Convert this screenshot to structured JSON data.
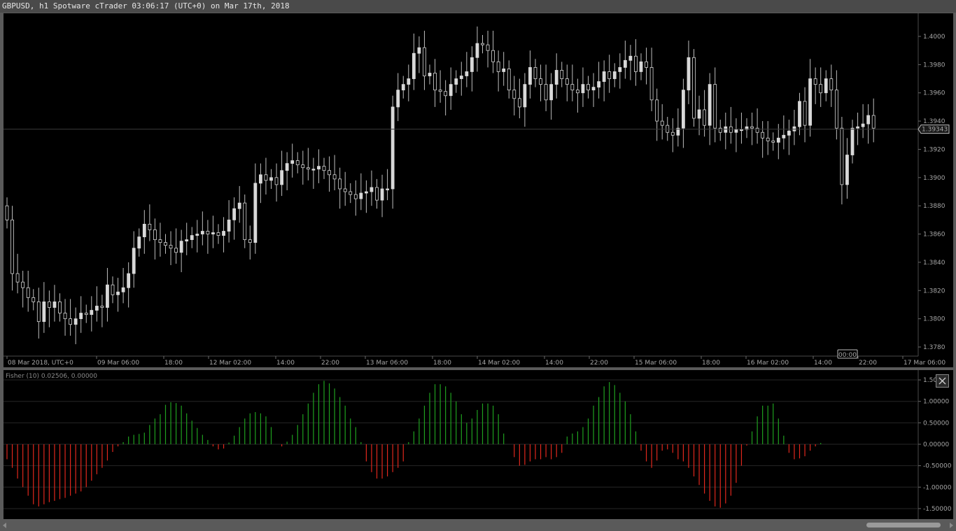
{
  "window": {
    "title": "GBPUSD, h1 Spotware cTrader 03:06:17 (UTC+0) on Mar 17th, 2018"
  },
  "colors": {
    "background": "#000000",
    "frame": "#5a5a5a",
    "candle": "#d8d8d8",
    "wick": "#bdbdbd",
    "grid": "#262626",
    "fisher_positive": "#1fa01f",
    "fisher_negative": "#e0271d",
    "price_line": "#3a3a3a"
  },
  "price_chart": {
    "current_price": "1.39343",
    "time_cursor_label": "00:00"
  },
  "indicator": {
    "label": "Fisher (10) 0.02506, 0.00000",
    "close_icon": "close-icon"
  },
  "chart_data": [
    {
      "type": "candlestick",
      "symbol": "GBPUSD",
      "timeframe": "h1",
      "ylim": [
        1.377,
        1.401
      ],
      "y_ticks": [
        "1.4000",
        "1.3980",
        "1.3960",
        "1.3940",
        "1.3920",
        "1.3900",
        "1.3880",
        "1.3860",
        "1.3840",
        "1.3820",
        "1.3800",
        "1.3780"
      ],
      "x_ticks": [
        "08 Mar 2018, UTC+0",
        "09 Mar 06:00",
        "18:00",
        "12 Mar 02:00",
        "14:00",
        "22:00",
        "13 Mar 06:00",
        "18:00",
        "14 Mar 02:00",
        "14:00",
        "22:00",
        "15 Mar 06:00",
        "18:00",
        "16 Mar 02:00",
        "14:00",
        "22:00",
        "17 Mar 06:00"
      ],
      "closes": [
        1.387,
        1.3832,
        1.3826,
        1.3822,
        1.3815,
        1.3812,
        1.3798,
        1.3812,
        1.3808,
        1.3812,
        1.3804,
        1.38,
        1.3796,
        1.38,
        1.3804,
        1.3803,
        1.3806,
        1.3809,
        1.3808,
        1.3824,
        1.3817,
        1.3819,
        1.3822,
        1.3832,
        1.385,
        1.3858,
        1.3867,
        1.3863,
        1.3856,
        1.3854,
        1.3852,
        1.385,
        1.3847,
        1.3855,
        1.3856,
        1.3859,
        1.386,
        1.3862,
        1.386,
        1.3861,
        1.3859,
        1.3862,
        1.387,
        1.3878,
        1.3882,
        1.3856,
        1.3854,
        1.3896,
        1.3902,
        1.3898,
        1.39,
        1.3895,
        1.3905,
        1.391,
        1.3912,
        1.3909,
        1.3907,
        1.3906,
        1.3906,
        1.3908,
        1.3905,
        1.3902,
        1.3899,
        1.3892,
        1.389,
        1.3888,
        1.3885,
        1.3889,
        1.389,
        1.3893,
        1.3884,
        1.3892,
        1.3892,
        1.395,
        1.3962,
        1.3966,
        1.397,
        1.3988,
        1.3992,
        1.3972,
        1.3974,
        1.3962,
        1.3961,
        1.3958,
        1.3966,
        1.397,
        1.3972,
        1.3975,
        1.3985,
        1.3995,
        1.3994,
        1.399,
        1.3982,
        1.3975,
        1.3977,
        1.3962,
        1.3956,
        1.395,
        1.3966,
        1.3978,
        1.397,
        1.3966,
        1.3955,
        1.3966,
        1.3976,
        1.397,
        1.3966,
        1.3962,
        1.396,
        1.3966,
        1.3962,
        1.3964,
        1.3968,
        1.3975,
        1.397,
        1.3975,
        1.3978,
        1.3983,
        1.3986,
        1.3975,
        1.3982,
        1.3978,
        1.3955,
        1.394,
        1.3937,
        1.3932,
        1.393,
        1.3935,
        1.3962,
        1.3985,
        1.3942,
        1.3948,
        1.3937,
        1.3966,
        1.3935,
        1.3932,
        1.3936,
        1.3932,
        1.3934,
        1.3934,
        1.3936,
        1.3935,
        1.3932,
        1.3928,
        1.3926,
        1.3925,
        1.3928,
        1.393,
        1.3933,
        1.3936,
        1.3954,
        1.3937,
        1.397,
        1.3966,
        1.396,
        1.397,
        1.3962,
        1.3935,
        1.3895,
        1.3916,
        1.3935,
        1.3936,
        1.3938,
        1.3944,
        1.3935
      ],
      "y_grid": false
    },
    {
      "type": "bar",
      "name": "Fisher (10)",
      "ylim": [
        -1.75,
        1.65
      ],
      "y_ticks": [
        "1.50000",
        "1.00000",
        "0.50000",
        "0.00000",
        "-0.50000",
        "-1.00000",
        "-1.50000"
      ],
      "values": [
        -0.35,
        -0.55,
        -0.8,
        -1.0,
        -1.2,
        -1.4,
        -1.45,
        -1.4,
        -1.35,
        -1.32,
        -1.28,
        -1.25,
        -1.2,
        -1.15,
        -1.1,
        -1.0,
        -0.85,
        -0.7,
        -0.55,
        -0.38,
        -0.18,
        -0.05,
        0.05,
        0.18,
        0.22,
        0.24,
        0.27,
        0.45,
        0.6,
        0.7,
        0.92,
        0.98,
        0.96,
        0.9,
        0.72,
        0.55,
        0.38,
        0.22,
        0.1,
        -0.05,
        -0.12,
        -0.1,
        0.04,
        0.2,
        0.4,
        0.6,
        0.72,
        0.75,
        0.72,
        0.65,
        0.4,
        0.0,
        -0.05,
        0.06,
        0.22,
        0.45,
        0.7,
        0.95,
        1.2,
        1.4,
        1.48,
        1.42,
        1.3,
        1.1,
        0.9,
        0.6,
        0.4,
        0.05,
        -0.4,
        -0.65,
        -0.8,
        -0.8,
        -0.75,
        -0.65,
        -0.55,
        -0.4,
        0.05,
        0.3,
        0.6,
        0.9,
        1.2,
        1.4,
        1.4,
        1.35,
        1.2,
        1.0,
        0.7,
        0.5,
        0.6,
        0.8,
        0.95,
        0.95,
        0.9,
        0.7,
        0.25,
        0.0,
        -0.3,
        -0.5,
        -0.48,
        -0.4,
        -0.35,
        -0.35,
        -0.3,
        -0.35,
        -0.3,
        -0.2,
        0.18,
        0.25,
        0.3,
        0.4,
        0.6,
        0.9,
        1.1,
        1.35,
        1.45,
        1.38,
        1.2,
        1.0,
        0.7,
        0.3,
        -0.15,
        -0.4,
        -0.55,
        -0.38,
        -0.15,
        -0.12,
        -0.2,
        -0.35,
        -0.4,
        -0.55,
        -0.75,
        -0.95,
        -1.15,
        -1.32,
        -1.45,
        -1.48,
        -1.38,
        -1.2,
        -0.9,
        -0.5,
        -0.03,
        0.3,
        0.65,
        0.9,
        0.9,
        0.95,
        0.6,
        0.2,
        -0.2,
        -0.35,
        -0.33,
        -0.28,
        -0.15,
        -0.05,
        0.03
      ],
      "y_grid": true
    }
  ]
}
